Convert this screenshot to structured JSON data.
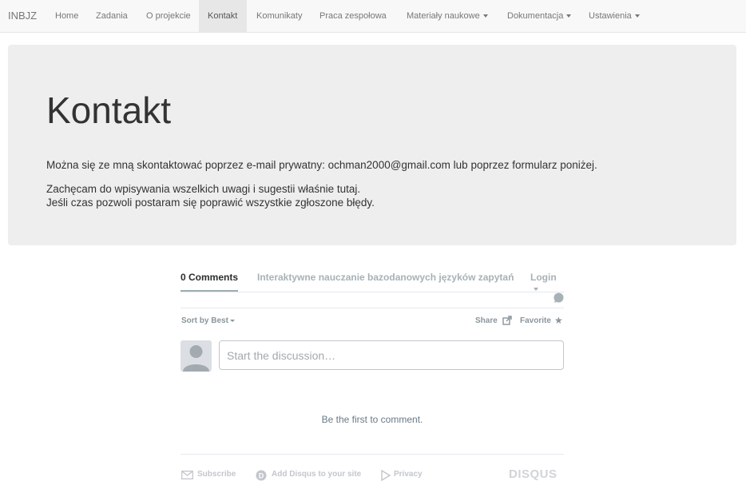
{
  "navbar": {
    "brand": "INBJZ",
    "items": [
      {
        "label": "Home"
      },
      {
        "label": "Zadania"
      },
      {
        "label": "O projekcie"
      },
      {
        "label": "Kontakt"
      },
      {
        "label": "Komunikaty"
      },
      {
        "label": "Praca zespołowa"
      },
      {
        "label": "Materiały naukowe"
      },
      {
        "label": "Dokumentacja"
      },
      {
        "label": "Ustawienia"
      }
    ]
  },
  "jumbotron": {
    "title": "Kontakt",
    "line1": "Można się ze mną skontaktować poprzez e-mail prywatny: ochman2000@gmail.com lub poprzez formularz poniżej.",
    "line2": "Zachęcam do wpisywania wszelkich uwagi i sugestii właśnie tutaj.",
    "line3": "Jeśli czas pozwoli postaram się poprawić wszystkie zgłoszone błędy."
  },
  "disqus": {
    "comments_tab": "0 Comments",
    "site_tab": "Interaktywne nauczanie bazodanowych języków zapytań",
    "login": "Login",
    "sort": "Sort by Best",
    "share": "Share",
    "favorite": "Favorite",
    "placeholder": "Start the discussion…",
    "empty": "Be the first to comment.",
    "subscribe": "Subscribe",
    "add_disqus": "Add Disqus to your site",
    "privacy": "Privacy",
    "logo": "DISQUS",
    "icons": [
      "comment-bubble-icon",
      "share-icon",
      "star-icon",
      "envelope-icon",
      "disqus-d-icon",
      "privacy-arrow-icon"
    ]
  },
  "colors": {
    "navbar_bg": "#f8f8f8",
    "jumbotron_bg": "#eeeeee",
    "muted": "#a8b1b6"
  }
}
